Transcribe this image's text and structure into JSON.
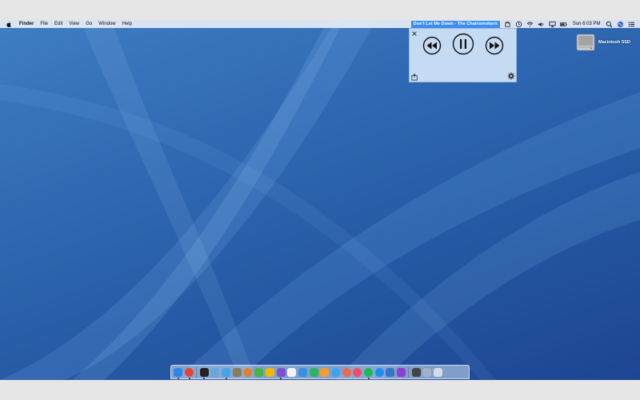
{
  "menubar": {
    "app_name": "Finder",
    "menus": [
      "File",
      "Edit",
      "View",
      "Go",
      "Window",
      "Help"
    ],
    "now_playing": "Don't Let Me Down - The Chainsmokers",
    "clock": "Sun 6:03 PM",
    "status_icons": [
      "wifi-icon",
      "volume-icon",
      "airplay-icon",
      "battery-icon",
      "search-icon",
      "siri-icon",
      "notification-center-icon"
    ]
  },
  "player": {
    "controls": [
      "close-icon",
      "rewind-button",
      "pause-button",
      "fast-forward-button",
      "share-icon",
      "settings-gear-icon"
    ]
  },
  "desktop": {
    "drive_label": "Macintosh SSD"
  },
  "dock": {
    "items": [
      {
        "name": "finder",
        "color": "#2f86e8",
        "running": true
      },
      {
        "name": "chrome",
        "color": "#e94335",
        "running": true,
        "round": true
      },
      {
        "name": "sep1",
        "sep": true
      },
      {
        "name": "terminal",
        "color": "#222222",
        "running": true
      },
      {
        "name": "preview",
        "color": "#6aa6d8"
      },
      {
        "name": "cleaner",
        "color": "#4aa3e8",
        "running": true
      },
      {
        "name": "archive",
        "color": "#8b7d5a"
      },
      {
        "name": "burn",
        "color": "#e0822d",
        "round": true
      },
      {
        "name": "leaf",
        "color": "#47b449"
      },
      {
        "name": "sketch",
        "color": "#f5b700"
      },
      {
        "name": "tasks",
        "color": "#7a52d1",
        "running": true
      },
      {
        "name": "calendar",
        "color": "#f4f4f4"
      },
      {
        "name": "keynote",
        "color": "#3b8ee0"
      },
      {
        "name": "numbers",
        "color": "#2fb35e"
      },
      {
        "name": "pages",
        "color": "#f39c32"
      },
      {
        "name": "messages",
        "color": "#34a6f5",
        "round": true
      },
      {
        "name": "photos",
        "color": "#e96b52",
        "round": true
      },
      {
        "name": "music",
        "color": "#f24a6c",
        "round": true
      },
      {
        "name": "spotify",
        "color": "#1db954",
        "round": true,
        "running": true
      },
      {
        "name": "appstore",
        "color": "#1d8ef0",
        "round": true
      },
      {
        "name": "textedit",
        "color": "#3575c8"
      },
      {
        "name": "podcast",
        "color": "#8b3fd1"
      },
      {
        "name": "sep2",
        "sep": true
      },
      {
        "name": "screens",
        "color": "#444444"
      },
      {
        "name": "folder",
        "color": "#9fb3c8"
      },
      {
        "name": "trash",
        "color": "#d6dbe2"
      }
    ]
  }
}
